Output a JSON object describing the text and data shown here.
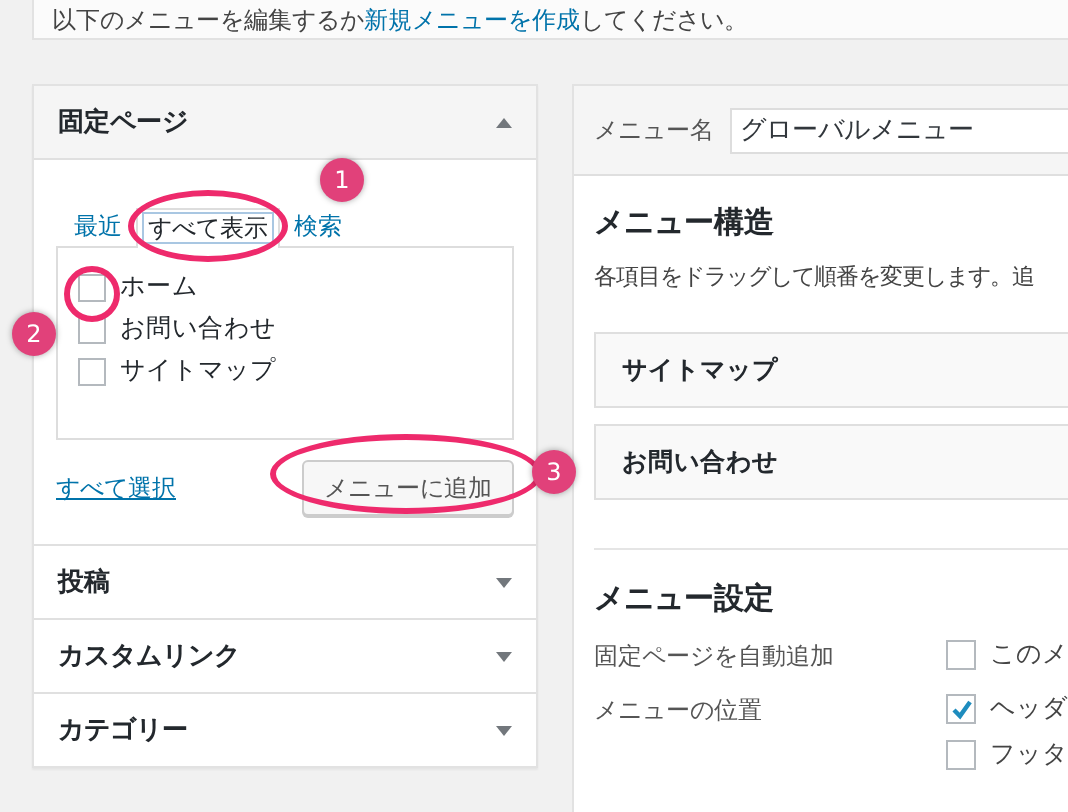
{
  "notice": {
    "before": "以下のメニューを編集するか",
    "link": "新規メニューを作成",
    "after": "してください。"
  },
  "left_panel": {
    "sections": [
      {
        "title": "固定ページ",
        "expanded": true,
        "tabs": [
          {
            "label": "最近",
            "selected": false
          },
          {
            "label": "すべて表示",
            "selected": true
          },
          {
            "label": "検索",
            "selected": false
          }
        ],
        "items": [
          {
            "label": "ホーム",
            "checked": false
          },
          {
            "label": "お問い合わせ",
            "checked": false
          },
          {
            "label": "サイトマップ",
            "checked": false
          }
        ],
        "select_all": "すべて選択",
        "add_button": "メニューに追加"
      },
      {
        "title": "投稿",
        "expanded": false
      },
      {
        "title": "カスタムリンク",
        "expanded": false
      },
      {
        "title": "カテゴリー",
        "expanded": false
      }
    ]
  },
  "menu_name": {
    "label": "メニュー名",
    "value": "グローバルメニュー"
  },
  "structure": {
    "title": "メニュー構造",
    "description": "各項目をドラッグして順番を変更します。追",
    "items": [
      "サイトマップ",
      "お問い合わせ"
    ]
  },
  "settings": {
    "title": "メニュー設定",
    "rows": [
      {
        "label": "固定ページを自動追加",
        "options": [
          {
            "label": "このメ",
            "checked": false
          }
        ]
      },
      {
        "label": "メニューの位置",
        "options": [
          {
            "label": "ヘッダ",
            "checked": true
          },
          {
            "label": "フッタ",
            "checked": false
          }
        ]
      }
    ]
  },
  "annotations": [
    {
      "number": "1"
    },
    {
      "number": "2"
    },
    {
      "number": "3"
    }
  ]
}
